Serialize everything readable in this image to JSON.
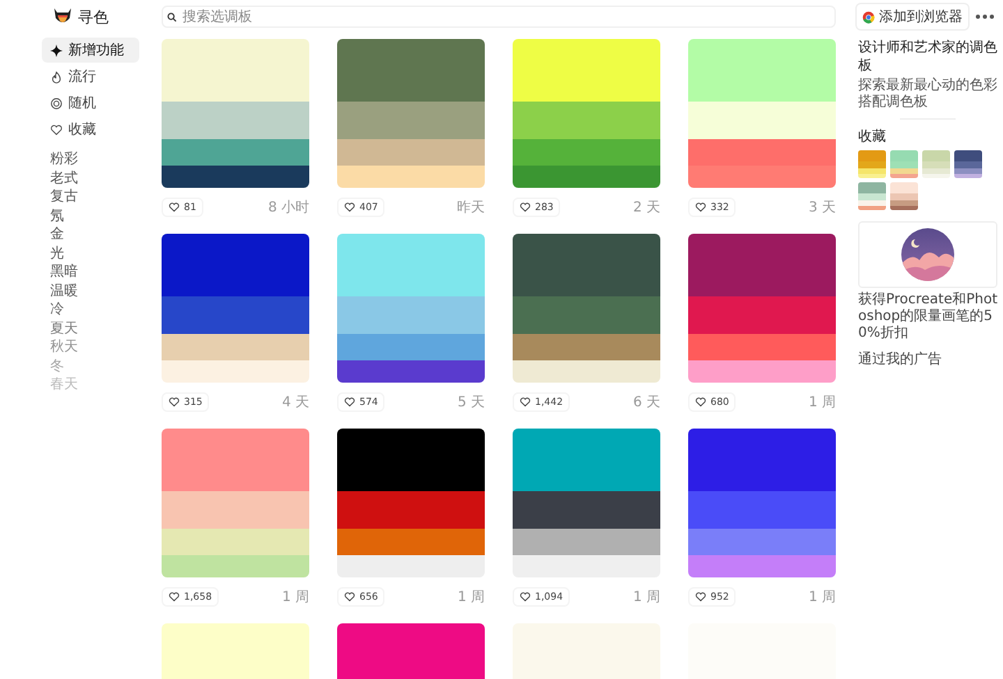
{
  "app": {
    "name": "寻色"
  },
  "search": {
    "placeholder": "搜索选调板"
  },
  "header_button": {
    "label": "添加到浏览器"
  },
  "nav": [
    {
      "label": "新增功能",
      "selected": true,
      "kind": "new"
    },
    {
      "label": "流行",
      "selected": false,
      "kind": "popular"
    },
    {
      "label": "随机",
      "selected": false,
      "kind": "random"
    },
    {
      "label": "收藏",
      "selected": false,
      "kind": "collection"
    }
  ],
  "tags": [
    "粉彩",
    "老式",
    "复古",
    "氖",
    "金",
    "光",
    "黑暗",
    "温暖",
    "冷",
    "夏天",
    "秋天",
    "冬",
    "春天"
  ],
  "palettes": [
    {
      "stripes": [
        {
          "color": "#f5f5d0"
        },
        {
          "color": "#bcd1c6"
        },
        {
          "color": "#4fa595"
        },
        {
          "color": "#1a3a5c"
        }
      ],
      "likes": "81",
      "age": "8 小时"
    },
    {
      "stripes": [
        {
          "color": "#5f7650"
        },
        {
          "color": "#9aa07f"
        },
        {
          "color": "#d0b894"
        },
        {
          "color": "#fbdba6"
        }
      ],
      "likes": "407",
      "age": "昨天"
    },
    {
      "stripes": [
        {
          "color": "#eefd45"
        },
        {
          "color": "#8cd04a"
        },
        {
          "color": "#55b23a"
        },
        {
          "color": "#3b9632"
        }
      ],
      "likes": "283",
      "age": "2 天"
    },
    {
      "stripes": [
        {
          "color": "#b3fca6"
        },
        {
          "color": "#f6fed8"
        },
        {
          "color": "#fe6e6a"
        },
        {
          "color": "#ff7b73"
        }
      ],
      "likes": "332",
      "age": "3 天"
    },
    {
      "stripes": [
        {
          "color": "#0b18c8"
        },
        {
          "color": "#2747c9"
        },
        {
          "color": "#e7cfae"
        },
        {
          "color": "#fcf1e2"
        }
      ],
      "likes": "315",
      "age": "4 天"
    },
    {
      "stripes": [
        {
          "color": "#7ee6ec"
        },
        {
          "color": "#8ac8e6"
        },
        {
          "color": "#5fa6dd"
        },
        {
          "color": "#5a3bce"
        }
      ],
      "likes": "574",
      "age": "5 天"
    },
    {
      "stripes": [
        {
          "color": "#3a5348"
        },
        {
          "color": "#4b6f51"
        },
        {
          "color": "#a88a5c"
        },
        {
          "color": "#efead3"
        }
      ],
      "likes": "1,442",
      "age": "6 天"
    },
    {
      "stripes": [
        {
          "color": "#9c1a5f"
        },
        {
          "color": "#e0184f"
        },
        {
          "color": "#ff5b5b"
        },
        {
          "color": "#fe9ec8"
        }
      ],
      "likes": "680",
      "age": "1 周"
    },
    {
      "stripes": [
        {
          "color": "#ff8b8b"
        },
        {
          "color": "#f8c4b0"
        },
        {
          "color": "#e5e8b2"
        },
        {
          "color": "#bfe3a0"
        }
      ],
      "likes": "1,658",
      "age": "1 周"
    },
    {
      "stripes": [
        {
          "color": "#000000"
        },
        {
          "color": "#cf1010"
        },
        {
          "color": "#e06508"
        },
        {
          "color": "#eeeeee"
        }
      ],
      "likes": "656",
      "age": "1 周"
    },
    {
      "stripes": [
        {
          "color": "#00a8b4"
        },
        {
          "color": "#3b3f48"
        },
        {
          "color": "#b0b0b0"
        },
        {
          "color": "#efefef"
        }
      ],
      "likes": "1,094",
      "age": "1 周"
    },
    {
      "stripes": [
        {
          "color": "#2d1ee6"
        },
        {
          "color": "#4a4cf8"
        },
        {
          "color": "#7a7ef9"
        },
        {
          "color": "#c47ef9"
        }
      ],
      "likes": "952",
      "age": "1 周"
    },
    {
      "stripes": [
        {
          "color": "#fdfec8"
        }
      ]
    },
    {
      "stripes": [
        {
          "color": "#ee0b84"
        }
      ]
    },
    {
      "stripes": [
        {
          "color": "#fbf8ec"
        }
      ]
    },
    {
      "stripes": [
        {
          "color": "#fdfcf8"
        }
      ]
    }
  ],
  "aside": {
    "title": "设计师和艺术家的调色板",
    "subtitle": "探索最新最心动的色彩搭配调色板"
  },
  "saved": {
    "title": "收藏",
    "palettes": [
      {
        "stripes": [
          {
            "color": "#e39a14"
          },
          {
            "color": "#e3a71a"
          },
          {
            "color": "#f5e56b"
          },
          {
            "color": "#f9f08f"
          }
        ]
      },
      {
        "stripes": [
          {
            "color": "#96dbb1"
          },
          {
            "color": "#9ee0b5"
          },
          {
            "color": "#f2d88f"
          },
          {
            "color": "#f4a58f"
          }
        ]
      },
      {
        "stripes": [
          {
            "color": "#c9d7a9"
          },
          {
            "color": "#d6deb8"
          },
          {
            "color": "#e6e9d3"
          },
          {
            "color": "#f5f5ec"
          }
        ]
      },
      {
        "stripes": [
          {
            "color": "#3f4d7d"
          },
          {
            "color": "#5a679a"
          },
          {
            "color": "#8d8fc1"
          },
          {
            "color": "#c1b0e0"
          }
        ]
      },
      {
        "stripes": [
          {
            "color": "#8eb5a1"
          },
          {
            "color": "#c8e6d1"
          },
          {
            "color": "#faf3ea"
          },
          {
            "color": "#f1a183"
          }
        ]
      },
      {
        "stripes": [
          {
            "color": "#fbe3d6"
          },
          {
            "color": "#ecc6b3"
          },
          {
            "color": "#c79c82"
          },
          {
            "color": "#a66f5c"
          }
        ]
      }
    ]
  },
  "ad": {
    "text": "获得Procreate和Photoshop的限量画笔的50%折扣",
    "link": "通过我的广告"
  }
}
